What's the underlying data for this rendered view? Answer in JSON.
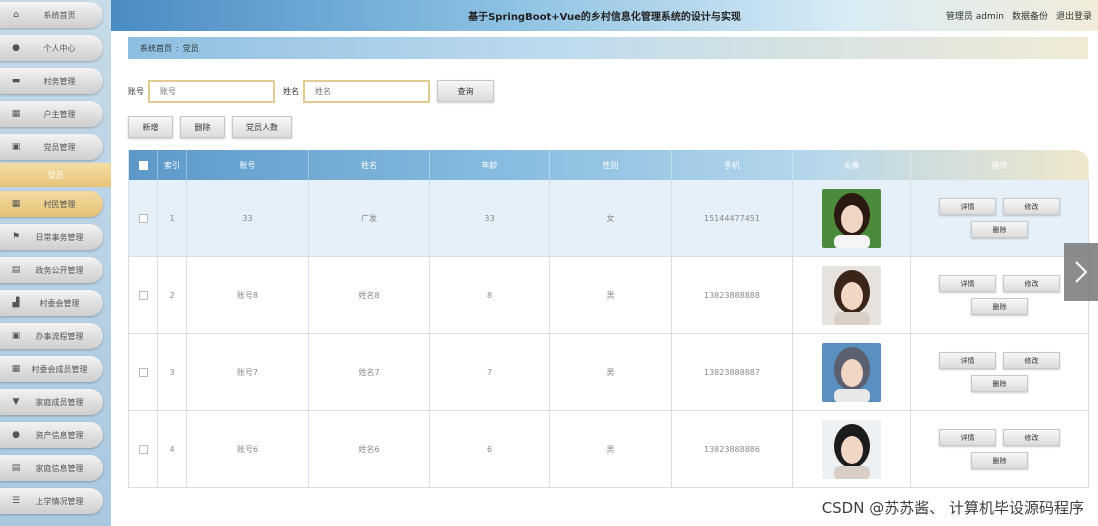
{
  "header": {
    "title": "基于SpringBoot+Vue的乡村信息化管理系统的设计与实现",
    "user": "管理员 admin",
    "backup": "数据备份",
    "logout": "退出登录"
  },
  "sidebar": {
    "items": [
      {
        "label": "系统首页",
        "icon": "home-icon"
      },
      {
        "label": "个人中心",
        "icon": "user-icon"
      },
      {
        "label": "村务管理",
        "icon": "card-icon"
      },
      {
        "label": "户主管理",
        "icon": "grid-icon"
      },
      {
        "label": "党员管理",
        "icon": "doc-icon"
      },
      {
        "label": "村民管理",
        "icon": "grid-icon",
        "active": true
      },
      {
        "label": "日常事务管理",
        "icon": "flag-icon"
      },
      {
        "label": "政务公开管理",
        "icon": "briefcase-icon"
      },
      {
        "label": "村委会管理",
        "icon": "chart-icon"
      },
      {
        "label": "办事流程管理",
        "icon": "doc-icon"
      },
      {
        "label": "村委会成员管理",
        "icon": "grid-icon"
      },
      {
        "label": "家庭成员管理",
        "icon": "funnel-icon"
      },
      {
        "label": "资产信息管理",
        "icon": "globe-icon"
      },
      {
        "label": "家庭信息管理",
        "icon": "list-icon"
      },
      {
        "label": "上学情况管理",
        "icon": "menu-icon"
      }
    ],
    "sub_item": "党员"
  },
  "breadcrumb": {
    "home": "系统首页",
    "sep": ":",
    "current": "党员"
  },
  "search": {
    "account_label": "账号",
    "account_placeholder": "账号",
    "name_label": "姓名",
    "name_placeholder": "姓名",
    "query_button": "查询"
  },
  "actions": {
    "add": "新增",
    "delete": "删除",
    "count": "党员人数"
  },
  "table": {
    "columns": [
      "索引",
      "账号",
      "姓名",
      "年龄",
      "性别",
      "手机",
      "头像",
      "操作"
    ],
    "rows": [
      {
        "index": "1",
        "account": "33",
        "name": "广发",
        "age": "33",
        "gender": "女",
        "phone": "15144477451",
        "highlight": true
      },
      {
        "index": "2",
        "account": "账号8",
        "name": "姓名8",
        "age": "8",
        "gender": "男",
        "phone": "13823888888"
      },
      {
        "index": "3",
        "account": "账号7",
        "name": "姓名7",
        "age": "7",
        "gender": "男",
        "phone": "13823888887"
      },
      {
        "index": "4",
        "account": "账号6",
        "name": "姓名6",
        "age": "6",
        "gender": "男",
        "phone": "13823888886"
      }
    ],
    "op_detail": "详情",
    "op_edit": "修改",
    "op_delete": "删除"
  },
  "watermark": "CSDN @苏苏酱、 计算机毕设源码程序"
}
